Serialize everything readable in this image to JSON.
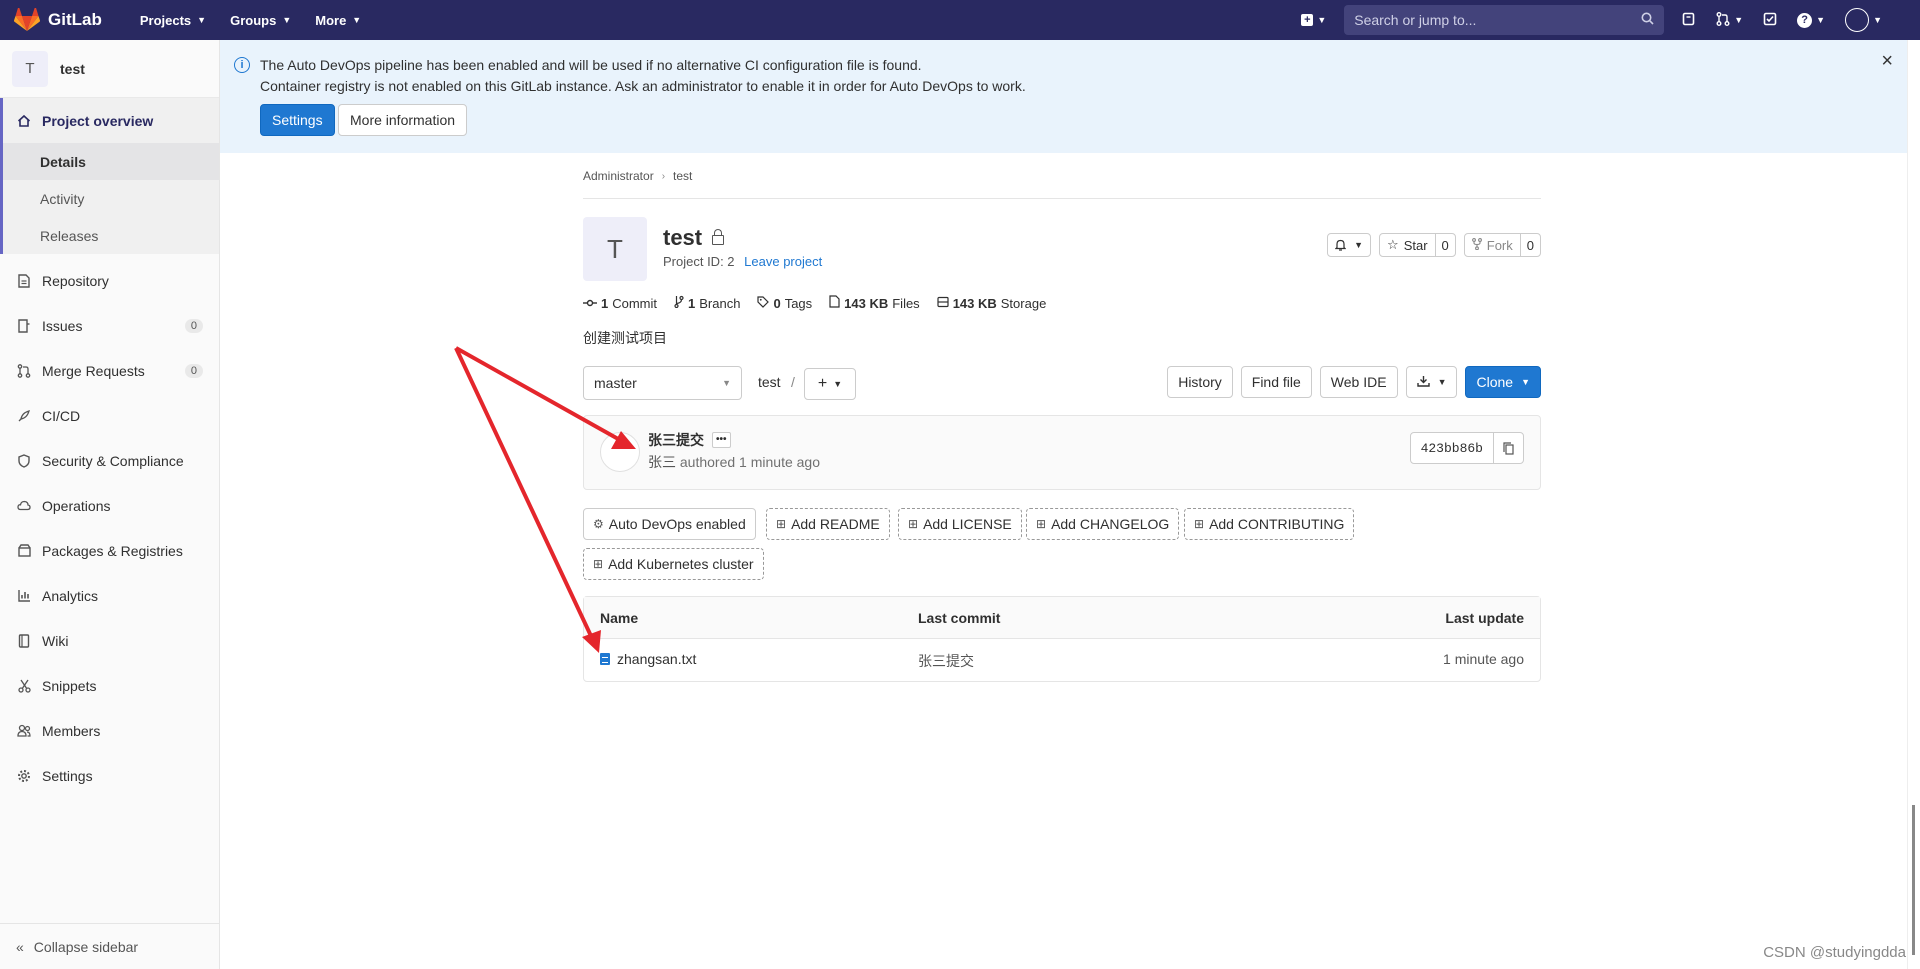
{
  "topbar": {
    "brand": "GitLab",
    "menus": [
      {
        "label": "Projects"
      },
      {
        "label": "Groups"
      },
      {
        "label": "More"
      }
    ],
    "search_placeholder": "Search or jump to..."
  },
  "sidebar": {
    "project_initial": "T",
    "project_name": "test",
    "overview_label": "Project overview",
    "sub_items": [
      "Details",
      "Activity",
      "Releases"
    ],
    "items": [
      {
        "label": "Repository",
        "icon": "doc-icon"
      },
      {
        "label": "Issues",
        "icon": "issues-icon",
        "count": "0"
      },
      {
        "label": "Merge Requests",
        "icon": "merge-request-icon",
        "count": "0"
      },
      {
        "label": "CI/CD",
        "icon": "rocket-icon"
      },
      {
        "label": "Security & Compliance",
        "icon": "shield-icon"
      },
      {
        "label": "Operations",
        "icon": "cloud-gear-icon"
      },
      {
        "label": "Packages & Registries",
        "icon": "package-icon"
      },
      {
        "label": "Analytics",
        "icon": "chart-icon"
      },
      {
        "label": "Wiki",
        "icon": "book-icon"
      },
      {
        "label": "Snippets",
        "icon": "scissors-icon"
      },
      {
        "label": "Members",
        "icon": "users-icon"
      },
      {
        "label": "Settings",
        "icon": "gear-icon"
      }
    ],
    "collapse_label": "Collapse sidebar"
  },
  "alert": {
    "line1": "The Auto DevOps pipeline has been enabled and will be used if no alternative CI configuration file is found.",
    "line2": "Container registry is not enabled on this GitLab instance. Ask an administrator to enable it in order for Auto DevOps to work.",
    "settings_label": "Settings",
    "more_label": "More information"
  },
  "breadcrumb": [
    "Administrator",
    "test"
  ],
  "project": {
    "initial": "T",
    "title": "test",
    "id_text": "Project ID: 2",
    "leave_label": "Leave project",
    "star_label": "Star",
    "star_count": "0",
    "fork_label": "Fork",
    "fork_count": "0",
    "description": "创建测试项目"
  },
  "stats": {
    "commits_n": "1",
    "commits_label": "Commit",
    "branches_n": "1",
    "branches_label": "Branch",
    "tags_n": "0",
    "tags_label": "Tags",
    "files_n": "143 KB",
    "files_label": "Files",
    "storage_n": "143 KB",
    "storage_label": "Storage"
  },
  "toolbar": {
    "branch": "master",
    "path_root": "test",
    "path_sep": "/",
    "history_label": "History",
    "find_file_label": "Find file",
    "web_ide_label": "Web IDE",
    "clone_label": "Clone"
  },
  "commit": {
    "title": "张三提交",
    "author": "张三",
    "authored_text": "authored 1 minute ago",
    "sha": "423bb86b"
  },
  "quick_actions": [
    "Auto DevOps enabled",
    "Add README",
    "Add LICENSE",
    "Add CHANGELOG",
    "Add CONTRIBUTING",
    "Add Kubernetes cluster"
  ],
  "file_tree": {
    "headers": [
      "Name",
      "Last commit",
      "Last update"
    ],
    "rows": [
      {
        "name": "zhangsan.txt",
        "last_commit": "张三提交",
        "last_update": "1 minute ago"
      }
    ]
  },
  "watermark": "CSDN @studyingdda",
  "colors": {
    "navbar": "#292961",
    "primary": "#1f78d1",
    "alert_bg": "#e9f3fc",
    "annotation": "#e4262c"
  }
}
